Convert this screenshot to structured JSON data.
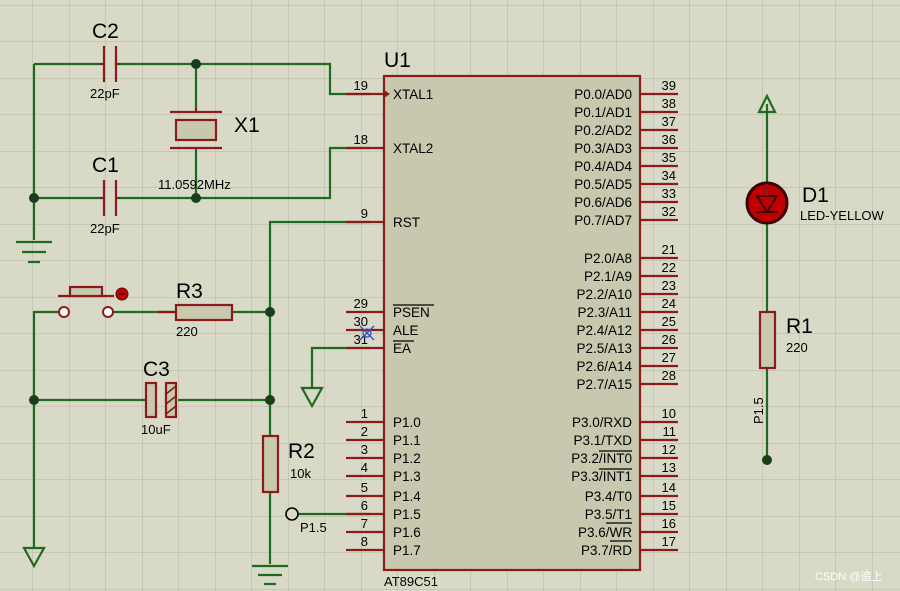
{
  "title": "",
  "ic": {
    "ref": "U1",
    "part": "AT89C51",
    "left_pins": [
      {
        "num": "19",
        "name": "XTAL1"
      },
      {
        "num": "18",
        "name": "XTAL2"
      },
      {
        "num": "9",
        "name": "RST"
      },
      {
        "num": "29",
        "name": "PSEN"
      },
      {
        "num": "30",
        "name": "ALE"
      },
      {
        "num": "31",
        "name": "EA"
      },
      {
        "num": "1",
        "name": "P1.0"
      },
      {
        "num": "2",
        "name": "P1.1"
      },
      {
        "num": "3",
        "name": "P1.2"
      },
      {
        "num": "4",
        "name": "P1.3"
      },
      {
        "num": "5",
        "name": "P1.4"
      },
      {
        "num": "6",
        "name": "P1.5"
      },
      {
        "num": "7",
        "name": "P1.6"
      },
      {
        "num": "8",
        "name": "P1.7"
      }
    ],
    "right_pins": [
      {
        "num": "39",
        "name": "P0.0/AD0"
      },
      {
        "num": "38",
        "name": "P0.1/AD1"
      },
      {
        "num": "37",
        "name": "P0.2/AD2"
      },
      {
        "num": "36",
        "name": "P0.3/AD3"
      },
      {
        "num": "35",
        "name": "P0.4/AD4"
      },
      {
        "num": "34",
        "name": "P0.5/AD5"
      },
      {
        "num": "33",
        "name": "P0.6/AD6"
      },
      {
        "num": "32",
        "name": "P0.7/AD7"
      },
      {
        "num": "21",
        "name": "P2.0/A8"
      },
      {
        "num": "22",
        "name": "P2.1/A9"
      },
      {
        "num": "23",
        "name": "P2.2/A10"
      },
      {
        "num": "24",
        "name": "P2.3/A11"
      },
      {
        "num": "25",
        "name": "P2.4/A12"
      },
      {
        "num": "26",
        "name": "P2.5/A13"
      },
      {
        "num": "27",
        "name": "P2.6/A14"
      },
      {
        "num": "28",
        "name": "P2.7/A15"
      },
      {
        "num": "10",
        "name": "P3.0/RXD"
      },
      {
        "num": "11",
        "name": "P3.1/TXD"
      },
      {
        "num": "12",
        "name": "P3.2/INT0"
      },
      {
        "num": "13",
        "name": "P3.3/INT1"
      },
      {
        "num": "14",
        "name": "P3.4/T0"
      },
      {
        "num": "15",
        "name": "P3.5/T1"
      },
      {
        "num": "16",
        "name": "P3.6/WR"
      },
      {
        "num": "17",
        "name": "P3.7/RD"
      }
    ]
  },
  "c1": {
    "ref": "C1",
    "value": "22pF"
  },
  "c2": {
    "ref": "C2",
    "value": "22pF"
  },
  "c3": {
    "ref": "C3",
    "value": "10uF"
  },
  "x1": {
    "ref": "X1",
    "value": "11.0592MHz"
  },
  "r1": {
    "ref": "R1",
    "value": "220"
  },
  "r2": {
    "ref": "R2",
    "value": "10k"
  },
  "r3": {
    "ref": "R3",
    "value": "220"
  },
  "d1": {
    "ref": "D1",
    "value": "LED-YELLOW"
  },
  "terminals": {
    "p15_left": "P1.5",
    "p15_right": "P1.5"
  },
  "watermark": "CSDN @追上",
  "colors": {
    "wire": "#1e6b1e",
    "component": "#8b1a1a",
    "ic_fill": "#c8c8ae",
    "background": "#d9d9c8",
    "led": "#c00000"
  }
}
